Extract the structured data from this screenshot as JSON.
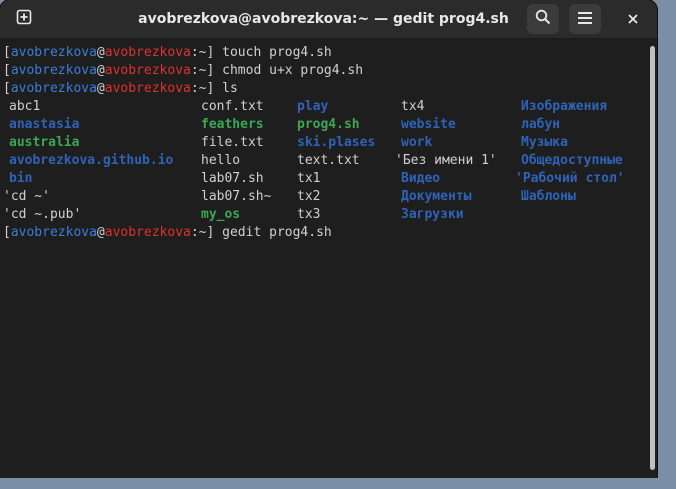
{
  "window": {
    "title": "avobrezkova@avobrezkova:~ — gedit prog4.sh"
  },
  "titlebar": {
    "new_tab_icon": "plus-square-icon",
    "search_icon": "search-icon",
    "menu_icon": "hamburger-menu-icon",
    "close_icon": "close-icon"
  },
  "prompt": {
    "open": "[",
    "user": "avobrezkova",
    "at": "@",
    "host": "avobrezkova",
    "path": ":~",
    "close": "]",
    "sigil": "$"
  },
  "commands": [
    "touch prog4.sh",
    "chmod u+x prog4.sh",
    "ls",
    "gedit prog4.sh"
  ],
  "ls_output": {
    "columns": [
      [
        {
          "name": "abc1",
          "kind": "file"
        },
        {
          "name": "anastasia",
          "kind": "dir"
        },
        {
          "name": "australia",
          "kind": "exec"
        },
        {
          "name": "avobrezkova.github.io",
          "kind": "dir"
        },
        {
          "name": "bin",
          "kind": "dir"
        },
        {
          "name": "'cd ~'",
          "kind": "file"
        },
        {
          "name": "'cd ~.pub'",
          "kind": "file"
        }
      ],
      [
        {
          "name": "conf.txt",
          "kind": "file"
        },
        {
          "name": "feathers",
          "kind": "exec"
        },
        {
          "name": "file.txt",
          "kind": "file"
        },
        {
          "name": "hello",
          "kind": "file"
        },
        {
          "name": "lab07.sh",
          "kind": "file"
        },
        {
          "name": "lab07.sh~",
          "kind": "file"
        },
        {
          "name": "my_os",
          "kind": "exec"
        }
      ],
      [
        {
          "name": "play",
          "kind": "dir"
        },
        {
          "name": "prog4.sh",
          "kind": "exec"
        },
        {
          "name": "ski.plases",
          "kind": "dir"
        },
        {
          "name": "text.txt",
          "kind": "file"
        },
        {
          "name": "tx1",
          "kind": "file"
        },
        {
          "name": "tx2",
          "kind": "file"
        },
        {
          "name": "tx3",
          "kind": "file"
        }
      ],
      [
        {
          "name": "tx4",
          "kind": "file"
        },
        {
          "name": "website",
          "kind": "dir"
        },
        {
          "name": "work",
          "kind": "dir"
        },
        {
          "name": "'Без имени 1'",
          "kind": "file"
        },
        {
          "name": "Видео",
          "kind": "dir"
        },
        {
          "name": "Документы",
          "kind": "dir"
        },
        {
          "name": "Загрузки",
          "kind": "dir"
        }
      ],
      [
        {
          "name": "Изображения",
          "kind": "dir"
        },
        {
          "name": "лабун",
          "kind": "dir"
        },
        {
          "name": "Музыка",
          "kind": "dir"
        },
        {
          "name": "Общедоступные",
          "kind": "dir"
        },
        {
          "name": "'Рабочий стол'",
          "kind": "dir"
        },
        {
          "name": "Шаблоны",
          "kind": "dir"
        }
      ]
    ]
  },
  "colors": {
    "user": "#3b7dd8",
    "host": "#e03030",
    "dir": "#2f63b8",
    "exec": "#3aa853",
    "text": "#d0d0d0",
    "background": "#1e1e1e"
  }
}
